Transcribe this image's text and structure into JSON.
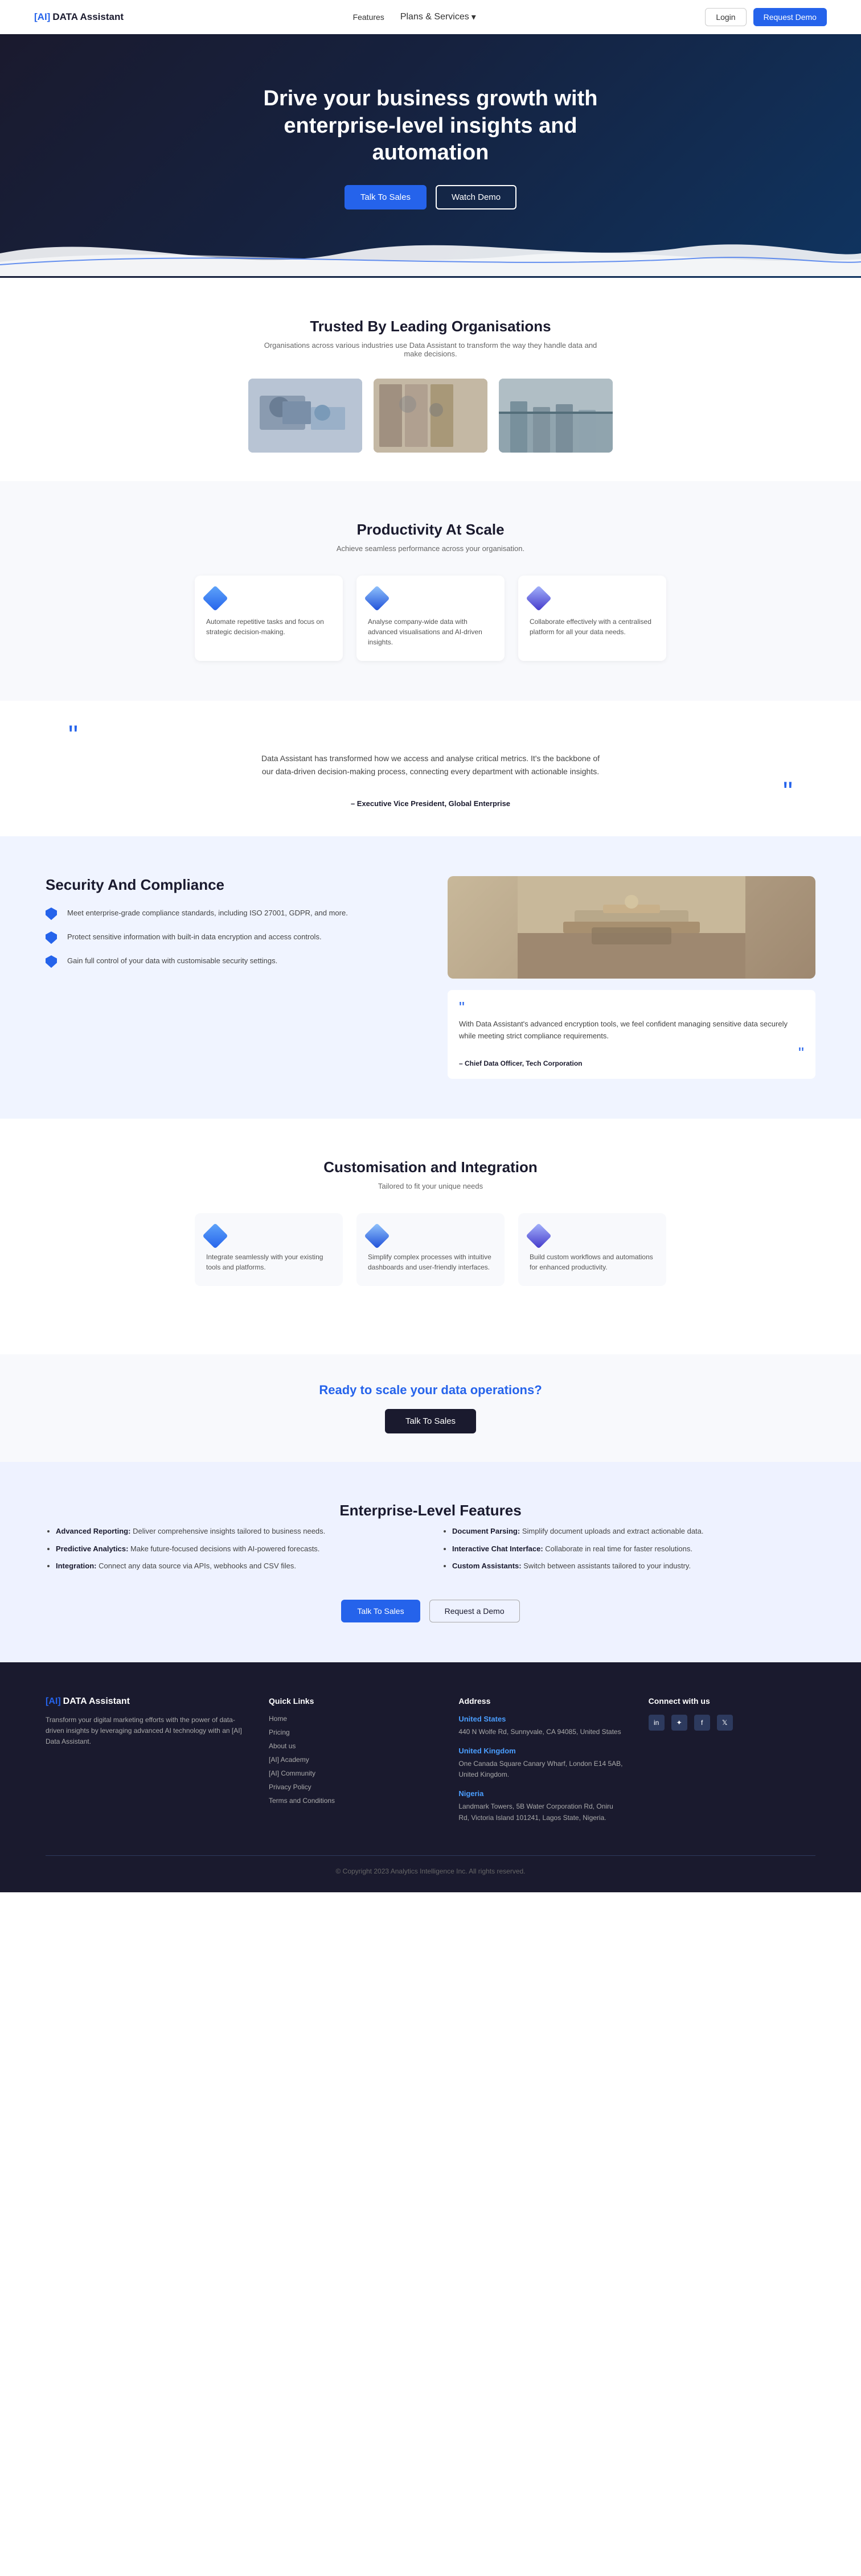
{
  "nav": {
    "logo_bracket": "[AI]",
    "logo_text": "DATA Assistant",
    "links": [
      {
        "label": "Features",
        "id": "features"
      },
      {
        "label": "Plans & Services",
        "id": "plans",
        "dropdown": true
      },
      {
        "label": "Login",
        "id": "login",
        "type": "btn-login"
      },
      {
        "label": "Request Demo",
        "id": "request-demo",
        "type": "btn-request"
      }
    ]
  },
  "hero": {
    "headline": "Drive your business growth with enterprise-level insights and automation",
    "btn_talk": "Talk To Sales",
    "btn_watch": "Watch Demo"
  },
  "trusted": {
    "heading": "Trusted By Leading Organisations",
    "subtext": "Organisations across various industries use Data Assistant to transform the way they handle data and make decisions."
  },
  "productivity": {
    "heading": "Productivity At Scale",
    "subtext": "Achieve seamless performance across your organisation.",
    "cards": [
      {
        "title": "Automate repetitive tasks and focus on strategic decision-making.",
        "desc": "Automate repetitive tasks and focus on strategic decision-making."
      },
      {
        "title": "Analyse company-wide data with advanced visualisations and AI-driven insights.",
        "desc": "Analyse company-wide data with advanced visualisations and AI-driven insights."
      },
      {
        "title": "Collaborate effectively centralised platform for all your data needs.",
        "desc": "Collaborate effectively with a centralised platform for all your data needs."
      }
    ]
  },
  "quote1": {
    "text": "Data Assistant has transformed how we access and analyse critical metrics. It's the backbone of our data-driven decision-making process, connecting every department with actionable insights.",
    "author": "– Executive Vice President, Global Enterprise"
  },
  "security": {
    "heading": "Security And Compliance",
    "items": [
      "Meet enterprise-grade compliance standards, including ISO 27001, GDPR, and more.",
      "Protect sensitive information with built-in data encryption and access controls.",
      "Gain full control of your data with customisable security settings."
    ],
    "quote": {
      "text": "With Data Assistant's advanced encryption tools, we feel confident managing sensitive data securely while meeting strict compliance requirements.",
      "author": "– Chief Data Officer, Tech Corporation"
    }
  },
  "customisation": {
    "heading": "Customisation and Integration",
    "subtext": "Tailored to fit your unique needs",
    "cards": [
      {
        "title": "Integrate seamlessly with your existing tools and platforms.",
        "desc": "Integrate seamlessly with your existing tools and platforms."
      },
      {
        "title": "Simplify complex processes with intuitive dashboards and user-friendly interfaces.",
        "desc": "Simplify complex processes with intuitive dashboards and user-friendly interfaces."
      },
      {
        "title": "Build custom workflows and automations for enhanced productivity.",
        "desc": "Build custom workflows and automations for enhanced productivity."
      }
    ]
  },
  "cta": {
    "heading_normal": "Ready to",
    "heading_highlight": "scale",
    "heading_end": "your data operations?",
    "btn_label": "Talk To Sales"
  },
  "enterprise": {
    "heading": "Enterprise-Level Features",
    "col1": [
      {
        "title": "Advanced Reporting:",
        "desc": "Deliver comprehensive insights tailored to business needs."
      },
      {
        "title": "Predictive Analytics:",
        "desc": "Make future-focused decisions with AI-powered forecasts."
      },
      {
        "title": "Integration:",
        "desc": "Connect any data source via APIs, webhooks and CSV files."
      }
    ],
    "col2": [
      {
        "title": "Document Parsing:",
        "desc": "Simplify document uploads and extract actionable data."
      },
      {
        "title": "Interactive Chat Interface:",
        "desc": "Collaborate in real time for faster resolutions."
      },
      {
        "title": "Custom Assistants:",
        "desc": "Switch between assistants tailored to your industry."
      }
    ],
    "btn_talk": "Talk To Sales",
    "btn_demo": "Request a Demo"
  },
  "footer": {
    "logo_bracket": "[AI]",
    "logo_text": "DATA Assistant",
    "brand_desc": "Transform your digital marketing efforts with the power of data-driven insights by leveraging advanced AI technology with an [AI] Data Assistant.",
    "quick_links": {
      "heading": "Quick Links",
      "items": [
        {
          "label": "Home"
        },
        {
          "label": "Pricing"
        },
        {
          "label": "About us"
        },
        {
          "label": "[AI] Academy"
        },
        {
          "label": "[AI] Community"
        },
        {
          "label": "Privacy Policy"
        },
        {
          "label": "Terms and Conditions"
        }
      ]
    },
    "address": {
      "heading": "Address",
      "locations": [
        {
          "country": "United States",
          "detail": "440 N Wolfe Rd, Sunnyvale, CA 94085, United States"
        },
        {
          "country": "United Kingdom",
          "detail": "One Canada Square Canary Wharf, London E14 5AB, United Kingdom."
        },
        {
          "country": "Nigeria",
          "detail": "Landmark Towers, 5B Water Corporation Rd, Oniru Rd, Victoria Island 101241, Lagos State, Nigeria."
        }
      ]
    },
    "connect": {
      "heading": "Connect with us",
      "socials": [
        "in",
        "✦",
        "f",
        "𝕏"
      ]
    },
    "copyright": "© Copyright 2023 Analytics Intelligence Inc. All rights reserved."
  }
}
